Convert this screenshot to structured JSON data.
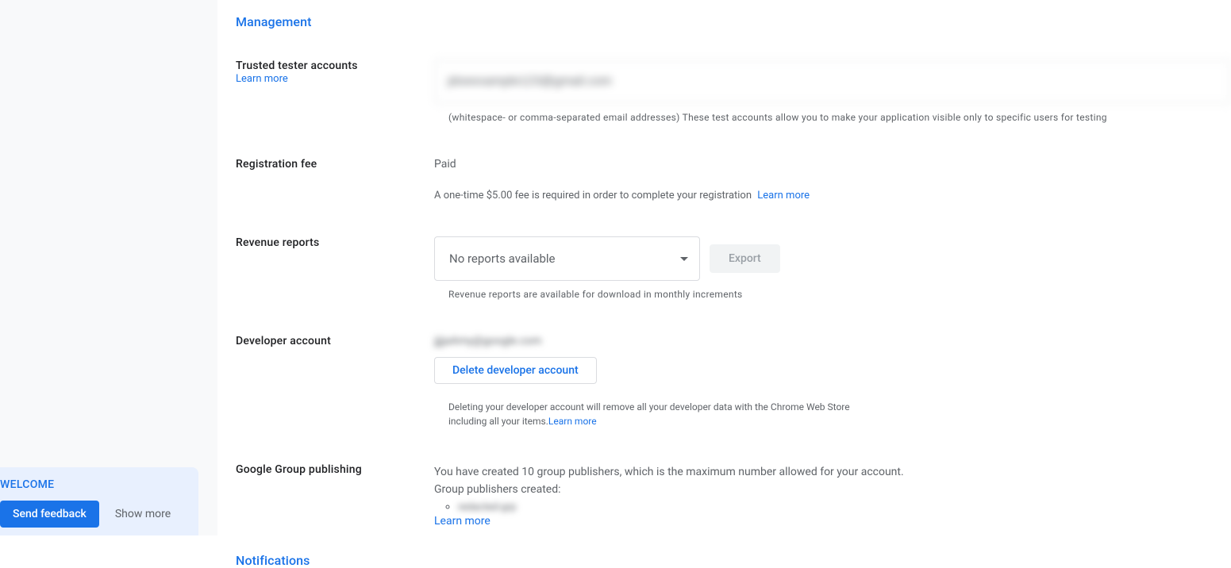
{
  "sections": {
    "management": "Management",
    "notifications": "Notifications"
  },
  "trustedTester": {
    "label": "Trusted tester accounts",
    "learnMore": "Learn more",
    "inputValue": "jdoeexample123@gmail.com",
    "helper": "(whitespace- or comma-separated email addresses) These test accounts allow you to make your application visible only to specific users for testing"
  },
  "registrationFee": {
    "label": "Registration fee",
    "value": "Paid",
    "desc": "A one-time $5.00 fee is required in order to complete your registration",
    "learnMore": "Learn more"
  },
  "revenueReports": {
    "label": "Revenue reports",
    "selectValue": "No reports available",
    "exportLabel": "Export",
    "helper": "Revenue reports are available for download in monthly increments"
  },
  "developerAccount": {
    "label": "Developer account",
    "email": "jjjjaAmy@google.com",
    "deleteLabel": "Delete developer account",
    "desc": "Deleting your developer account will remove all your developer data with the Chrome Web Store including all your items.",
    "learnMore": "Learn more"
  },
  "groupPublishing": {
    "label": "Google Group publishing",
    "desc": "You have created 10 group publishers, which is the maximum number allowed for your account.",
    "createdLabel": "Group publishers created:",
    "item": "redacted-grp",
    "learnMore": "Learn more"
  },
  "feedback": {
    "welcome": "WELCOME",
    "sendFeedback": "Send feedback",
    "showMore": "Show more"
  }
}
